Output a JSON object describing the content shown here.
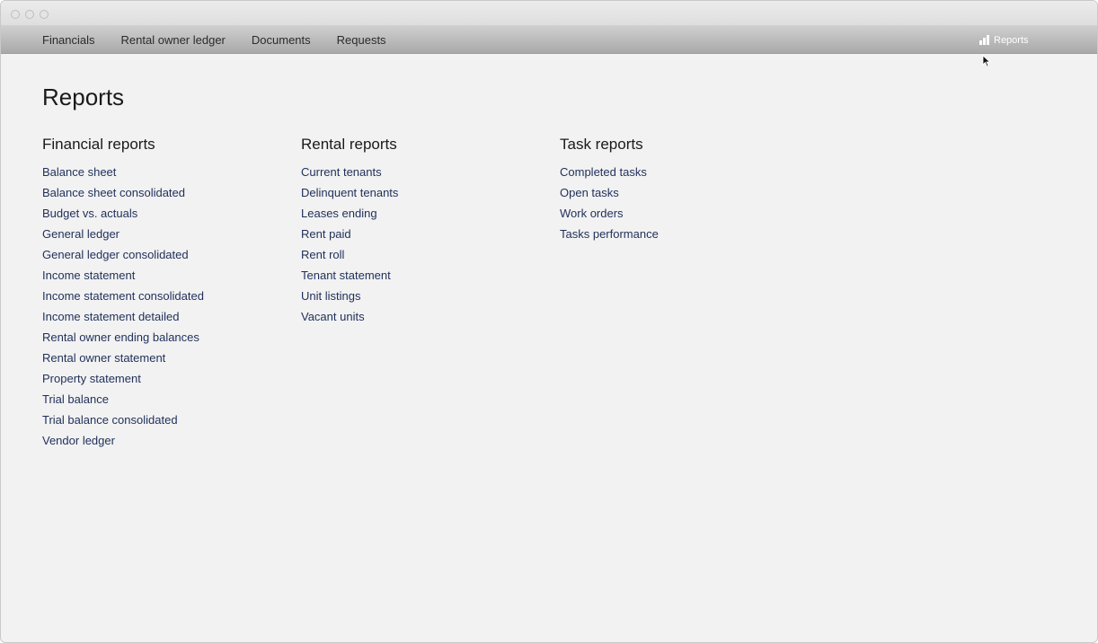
{
  "nav": {
    "items": [
      "Financials",
      "Rental owner ledger",
      "Documents",
      "Requests"
    ],
    "reports_label": "Reports"
  },
  "page": {
    "title": "Reports"
  },
  "columns": [
    {
      "heading": "Financial reports",
      "items": [
        "Balance sheet",
        "Balance sheet consolidated",
        "Budget vs. actuals",
        "General ledger",
        "General ledger consolidated",
        "Income statement",
        "Income statement consolidated",
        "Income statement detailed",
        "Rental owner ending balances",
        "Rental owner statement",
        "Property statement",
        "Trial balance",
        "Trial balance consolidated",
        "Vendor ledger"
      ]
    },
    {
      "heading": "Rental reports",
      "items": [
        "Current tenants",
        "Delinquent tenants",
        "Leases ending",
        "Rent paid",
        "Rent roll",
        "Tenant statement",
        "Unit listings",
        "Vacant units"
      ]
    },
    {
      "heading": "Task reports",
      "items": [
        "Completed tasks",
        "Open tasks",
        "Work orders",
        "Tasks performance"
      ]
    }
  ],
  "icons": {
    "reports": "bar-chart-icon",
    "cursor": "mouse-pointer-icon"
  },
  "colors": {
    "link": "#1f2f5a",
    "background": "#f2f2f2",
    "navbar": "#bdbdbd"
  }
}
